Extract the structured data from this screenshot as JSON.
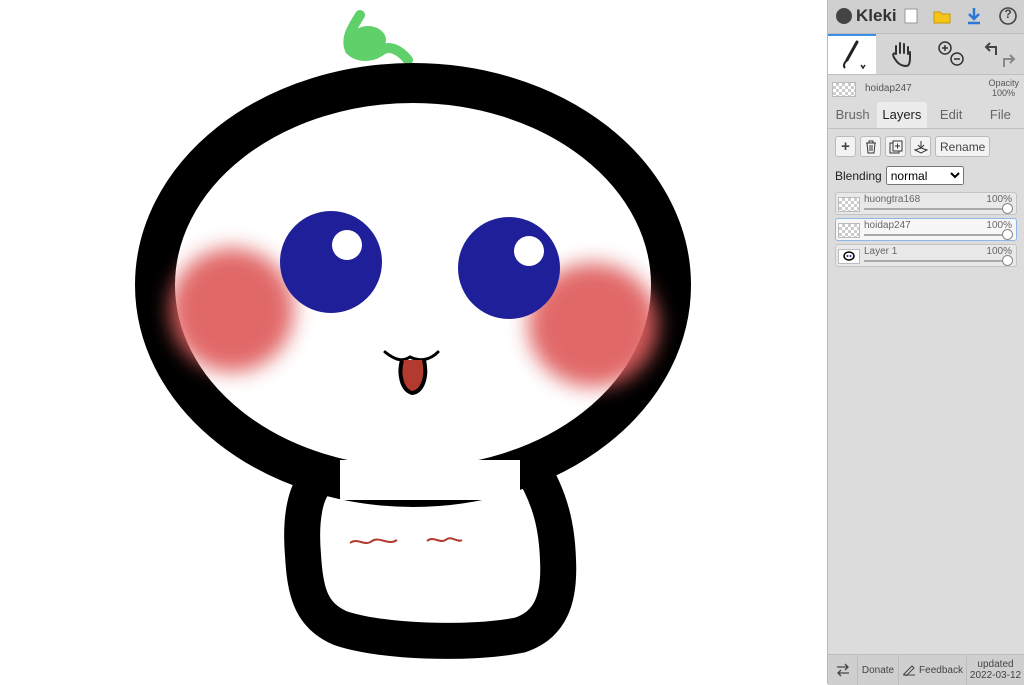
{
  "app": {
    "name": "Kleki"
  },
  "topbar": {
    "icons": [
      "new-image-icon",
      "open-folder-icon",
      "download-icon",
      "help-icon"
    ],
    "help_glyph": "?"
  },
  "tools": {
    "brush": "brush-icon",
    "hand": "hand-icon",
    "zoom": "zoom-icon",
    "undo_redo": "undo-redo-icon"
  },
  "current_layer": {
    "name": "hoidap247",
    "opacity_label": "Opacity",
    "opacity_value": "100%"
  },
  "tabs": [
    {
      "label": "Brush",
      "active": false
    },
    {
      "label": "Layers",
      "active": true
    },
    {
      "label": "Edit",
      "active": false
    },
    {
      "label": "File",
      "active": false
    }
  ],
  "layer_tools": {
    "add": "+",
    "rename": "Rename"
  },
  "blending": {
    "label": "Blending",
    "value": "normal",
    "options": [
      "normal"
    ]
  },
  "layers": [
    {
      "name": "huongtra168",
      "opacity": "100%",
      "selected": false
    },
    {
      "name": "hoidap247",
      "opacity": "100%",
      "selected": true
    },
    {
      "name": "Layer 1",
      "opacity": "100%",
      "selected": false
    }
  ],
  "footer": {
    "donate": "Donate",
    "feedback": "Feedback",
    "updated_label": "updated",
    "updated_date": "2022-03-12"
  },
  "colors": {
    "accent": "#3a8de8",
    "outline": "#000000",
    "eyes": "#1f1f9a",
    "cheeks": "#e06060",
    "tongue": "#b33a2e",
    "sprout": "#5fd06a"
  }
}
